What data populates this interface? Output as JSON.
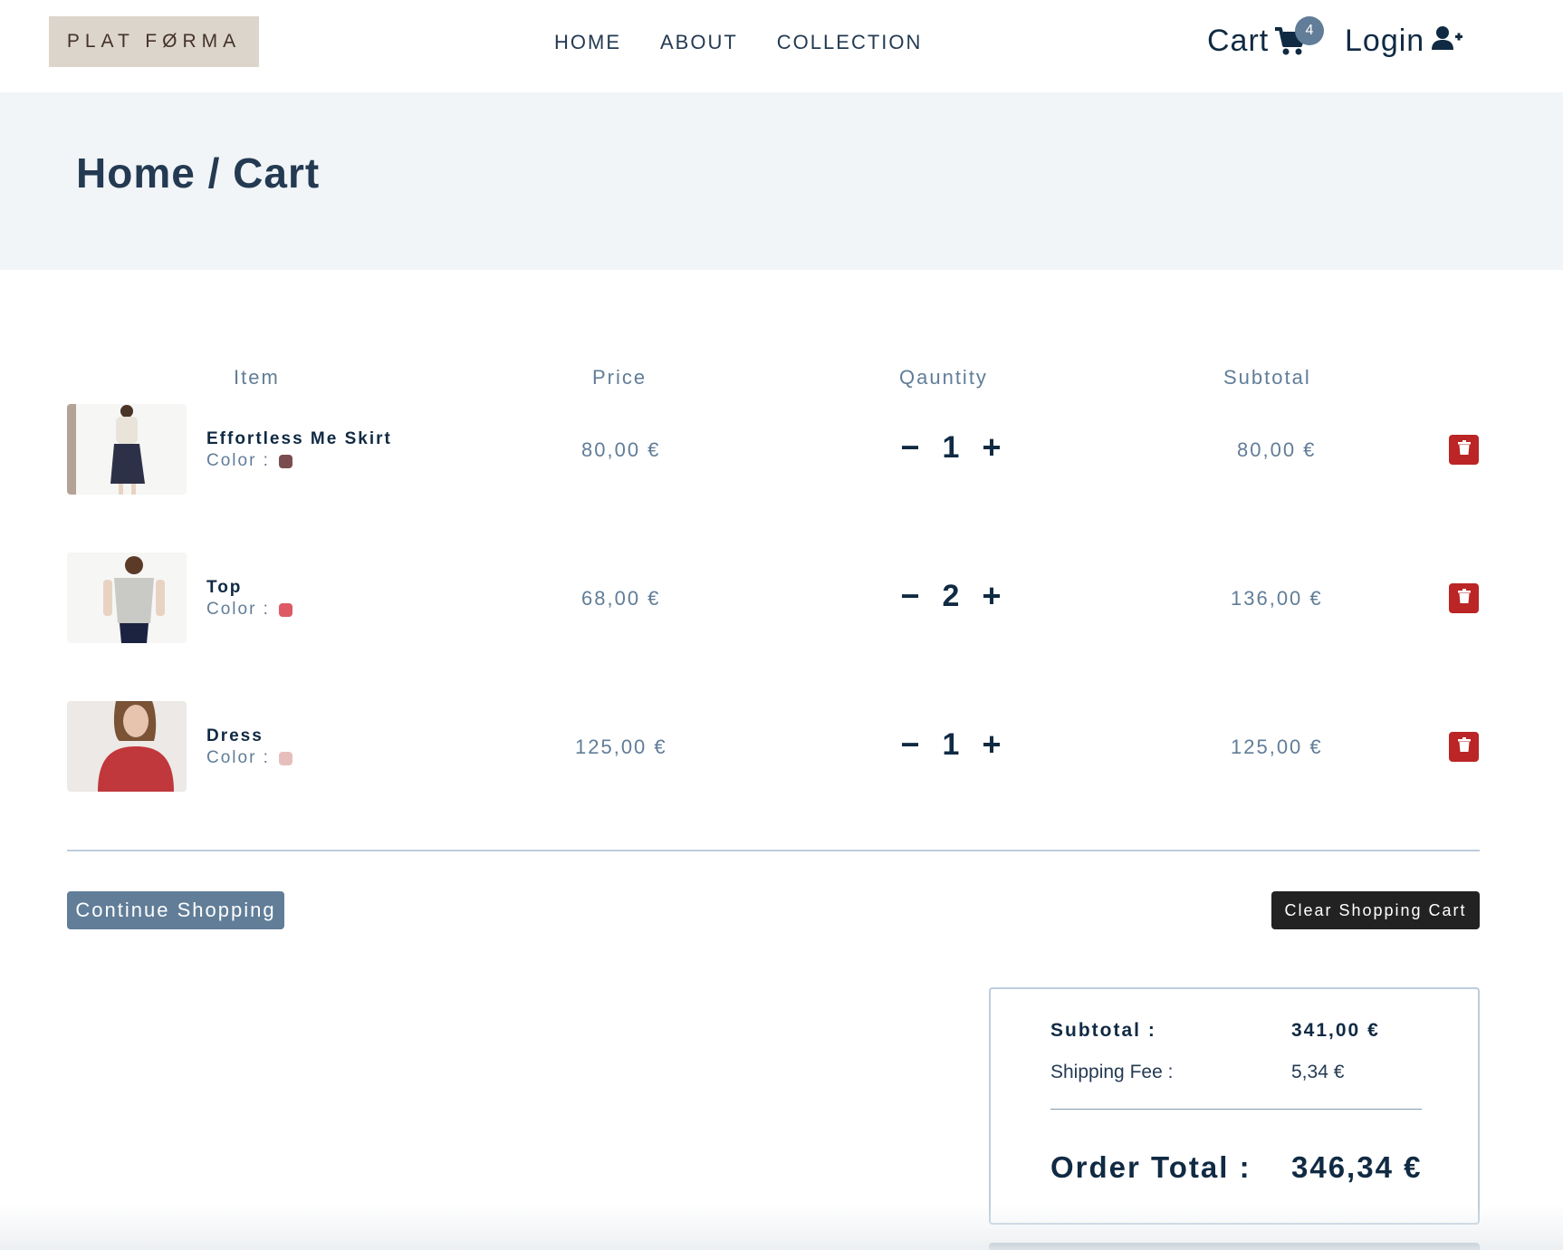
{
  "brand": {
    "logo_text": "PLAT FØRMA"
  },
  "nav": {
    "links": [
      "HOME",
      "ABOUT",
      "COLLECTION"
    ],
    "cart_label": "Cart",
    "cart_count": "4",
    "login_label": "Login"
  },
  "hero": {
    "home": "Home",
    "separator": "/",
    "current": "Cart"
  },
  "table": {
    "headers": [
      "Item",
      "Price",
      "Qauntity",
      "Subtotal"
    ]
  },
  "items": [
    {
      "name": "Effortless Me Skirt",
      "color_label": "Color :",
      "color": "#7a4d4f",
      "price": "80,00 €",
      "quantity": "1",
      "subtotal": "80,00 €"
    },
    {
      "name": "Top",
      "color_label": "Color :",
      "color": "#dd5a65",
      "price": "68,00 €",
      "quantity": "2",
      "subtotal": "136,00 €"
    },
    {
      "name": "Dress",
      "color_label": "Color :",
      "color": "#e6bfbd",
      "price": "125,00 €",
      "quantity": "1",
      "subtotal": "125,00 €"
    }
  ],
  "qty_controls": {
    "decrease": "−",
    "increase": "+"
  },
  "actions": {
    "continue": "Continue Shopping",
    "clear": "Clear Shopping Cart"
  },
  "totals": {
    "subtotal_label": "Subtotal :",
    "subtotal_value": "341,00 €",
    "shipping_label": "Shipping Fee :",
    "shipping_value": "5,34 €",
    "order_total_label": "Order Total :",
    "order_total_value": "346,34 €"
  },
  "colors": {
    "primary": "#617d98",
    "danger": "#bb2525",
    "dark": "#102a43",
    "hero_bg": "#f1f5f8"
  }
}
